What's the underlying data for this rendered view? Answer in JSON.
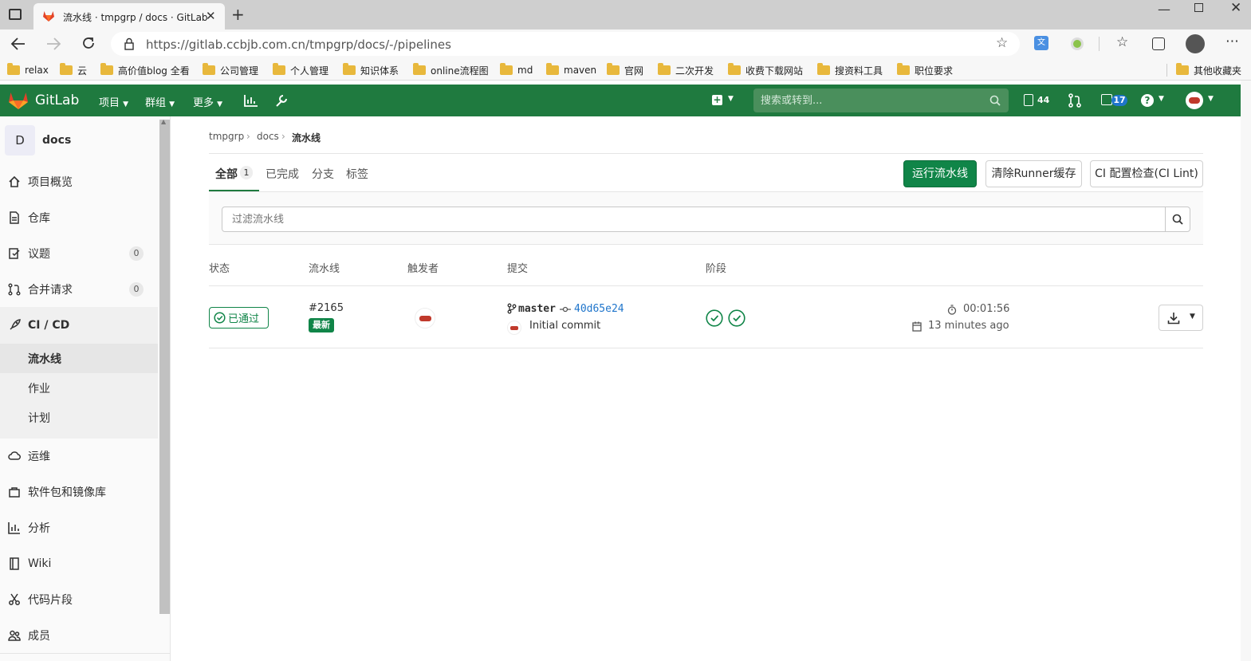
{
  "browser": {
    "tab_title": "流水线 · tmpgrp / docs · GitLab",
    "url": "https://gitlab.ccbjb.com.cn/tmpgrp/docs/-/pipelines",
    "bookmarks": [
      "relax",
      "云",
      "高价值blog 全看",
      "公司管理",
      "个人管理",
      "知识体系",
      "online流程图",
      "md",
      "maven",
      "官网",
      "二次开发",
      "收费下载网站",
      "搜资料工具",
      "职位要求"
    ],
    "other_bookmarks": "其他收藏夹"
  },
  "header": {
    "brand": "GitLab",
    "nav": [
      "项目",
      "群组",
      "更多"
    ],
    "search_placeholder": "搜索或转到...",
    "todo_count": "44",
    "issues_count": "17"
  },
  "sidebar": {
    "project_initial": "D",
    "project_name": "docs",
    "items": [
      {
        "label": "项目概览"
      },
      {
        "label": "仓库"
      },
      {
        "label": "议题",
        "count": "0"
      },
      {
        "label": "合并请求",
        "count": "0"
      },
      {
        "label": "CI / CD"
      },
      {
        "label": "运维"
      },
      {
        "label": "软件包和镜像库"
      },
      {
        "label": "分析"
      },
      {
        "label": "Wiki"
      },
      {
        "label": "代码片段"
      },
      {
        "label": "成员"
      }
    ],
    "cicd_sub": [
      "流水线",
      "作业",
      "计划"
    ]
  },
  "breadcrumb": [
    "tmpgrp",
    "docs",
    "流水线"
  ],
  "tabs": [
    {
      "label": "全部",
      "count": "1"
    },
    {
      "label": "已完成"
    },
    {
      "label": "分支"
    },
    {
      "label": "标签"
    }
  ],
  "buttons": {
    "run_pipeline": "运行流水线",
    "clear_cache": "清除Runner缓存",
    "ci_lint": "CI 配置检查(CI Lint)"
  },
  "filter_placeholder": "过滤流水线",
  "table": {
    "headers": [
      "状态",
      "流水线",
      "触发者",
      "提交",
      "阶段"
    ],
    "rows": [
      {
        "status": "已通过",
        "pipeline_id": "#2165",
        "latest_badge": "最新",
        "branch": "master",
        "commit_sha": "40d65e24",
        "commit_message": "Initial commit",
        "duration": "00:01:56",
        "finished": "13 minutes ago"
      }
    ]
  },
  "colors": {
    "header_green": "#1f7a3f",
    "success": "#108548",
    "link": "#1f75cb"
  }
}
